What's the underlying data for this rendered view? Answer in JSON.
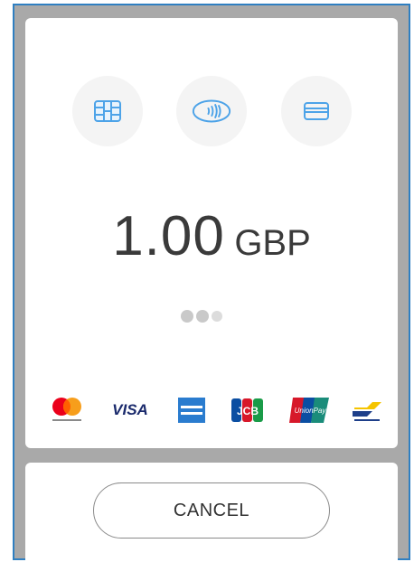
{
  "payment_methods": [
    {
      "name": "chip-card-icon"
    },
    {
      "name": "contactless-icon"
    },
    {
      "name": "swipe-card-icon"
    }
  ],
  "amount": {
    "value": "1.00",
    "currency": "GBP"
  },
  "progress": {
    "dot_count": 3
  },
  "brands": [
    {
      "name": "mastercard-logo",
      "text": "mastercard"
    },
    {
      "name": "visa-logo",
      "text": "VISA"
    },
    {
      "name": "amex-logo",
      "text": "AMERICAN EXPRESS"
    },
    {
      "name": "jcb-logo",
      "text": "JCB"
    },
    {
      "name": "unionpay-logo",
      "text": "UnionPay 银联"
    },
    {
      "name": "bancontact-logo",
      "text": "Bancontact"
    }
  ],
  "colors": {
    "accent": "#4da3e8",
    "frame_border": "#2f7fc1",
    "backdrop": "#a9a9a9"
  },
  "cancel_button": {
    "label": "CANCEL"
  }
}
